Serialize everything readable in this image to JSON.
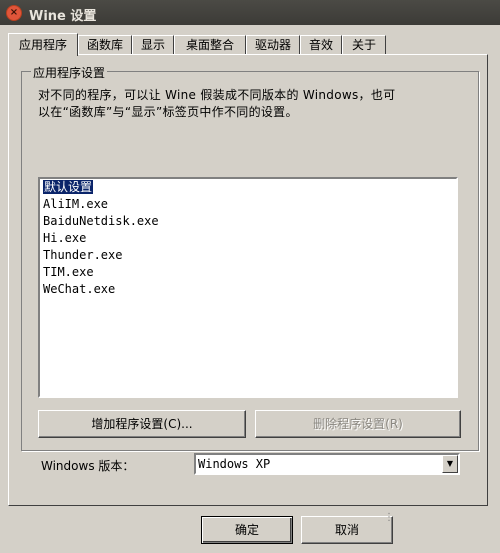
{
  "window": {
    "title": "Wine 设置",
    "close_glyph": "×"
  },
  "tabs": [
    {
      "label": "应用程序",
      "active": true
    },
    {
      "label": "函数库"
    },
    {
      "label": "显示"
    },
    {
      "label": "桌面整合"
    },
    {
      "label": "驱动器"
    },
    {
      "label": "音效"
    },
    {
      "label": "关于"
    }
  ],
  "app_settings": {
    "group_label": "应用程序设置",
    "description": "对不同的程序，可以让 Wine 假装成不同版本的 Windows，也可\n以在“函数库”与“显示”标签页中作不同的设置。",
    "applications": [
      "默认设置",
      "AliIM.exe",
      "BaiduNetdisk.exe",
      "Hi.exe",
      "Thunder.exe",
      "TIM.exe",
      "WeChat.exe"
    ],
    "selected_index": 0,
    "add_button": "增加程序设置(C)...",
    "remove_button": "删除程序设置(R)",
    "windows_version_label": "Windows 版本：",
    "windows_version_value": "Windows XP"
  },
  "footer": {
    "ok_label": "确定",
    "cancel_label": "取消"
  }
}
